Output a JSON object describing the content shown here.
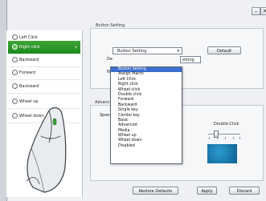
{
  "window": {
    "controls": [
      "–",
      "✕"
    ]
  },
  "sidebar": {
    "items": [
      {
        "label": "Left Click",
        "active": false
      },
      {
        "label": "Right click",
        "active": true
      },
      {
        "label": "Backward",
        "active": false
      },
      {
        "label": "Forward",
        "active": false
      },
      {
        "label": "Backward",
        "active": false
      },
      {
        "label": "Wheel up",
        "active": false
      },
      {
        "label": "Wheel down",
        "active": false
      }
    ]
  },
  "button_setting": {
    "group_title": "Button Setting",
    "combo_value": "Button Setting",
    "default_label": "Default",
    "field_prefix_1": "De",
    "field_prefix_2": "Na",
    "assign_text": "etting"
  },
  "dropdown": {
    "items": [
      "Assign Macro",
      "Left Click",
      "Right click",
      "Wheel click",
      "Double click",
      "Forward",
      "Backward",
      "Single key",
      "Combo key",
      "Basic",
      "Advanced",
      "Media",
      "Wheel up",
      "Wheel down",
      "Disabled"
    ],
    "selected": "Button Setting"
  },
  "advanced": {
    "group_title": "Advanc",
    "speed_prefix": "Spee"
  },
  "double_click": {
    "label": "Double-Click"
  },
  "footer": {
    "restore_defaults": "Restore Defaults",
    "apply": "Apply",
    "discard": "Discard"
  },
  "colors": {
    "accent": "#2a9a2a",
    "selection": "#3a6fd0"
  }
}
